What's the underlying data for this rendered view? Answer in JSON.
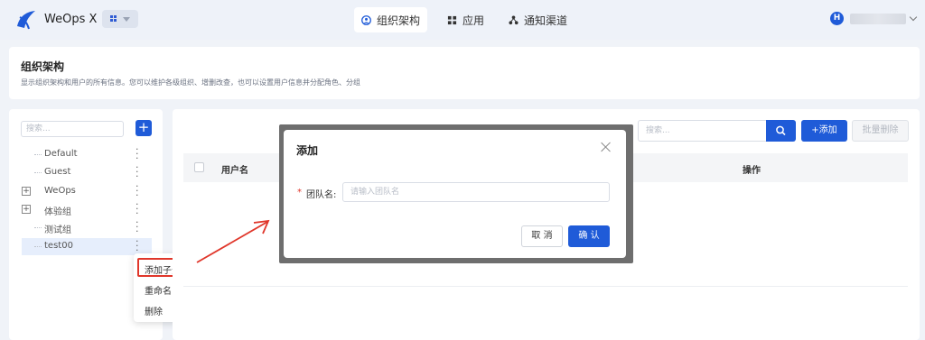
{
  "app": {
    "name": "WeOps X",
    "avatar_letter": "H"
  },
  "nav": [
    {
      "label": "组织架构",
      "icon": "org-icon",
      "active": true
    },
    {
      "label": "应用",
      "icon": "apps-icon",
      "active": false
    },
    {
      "label": "通知渠道",
      "icon": "channel-icon",
      "active": false
    }
  ],
  "header": {
    "title": "组织架构",
    "description": "显示组织架构和用户的所有信息。您可以维护各级组织、增删改查，也可以设置用户信息并分配角色、分组"
  },
  "tree": {
    "search_placeholder": "搜索...",
    "items": [
      {
        "label": "Default",
        "expandable": false
      },
      {
        "label": "Guest",
        "expandable": false
      },
      {
        "label": "WeOps",
        "expandable": true
      },
      {
        "label": "体验组",
        "expandable": true
      },
      {
        "label": "测试组",
        "expandable": false
      },
      {
        "label": "test00",
        "expandable": false,
        "selected": true
      }
    ]
  },
  "context_menu": {
    "items": [
      "添加子分组",
      "重命名",
      "删除"
    ],
    "highlighted": "添加子分组"
  },
  "toolbar": {
    "search_placeholder": "搜索...",
    "add_label": "+添加",
    "batch_delete_label": "批量删除"
  },
  "table": {
    "columns": [
      "用户名",
      "操作"
    ]
  },
  "dialog": {
    "title": "添加",
    "field_label": "团队名:",
    "field_required_mark": "*",
    "field_placeholder": "请输入团队名",
    "cancel_label": "取 消",
    "ok_label": "确 认"
  },
  "colors": {
    "primary": "#1f5bd8",
    "annotation": "#e0362a"
  }
}
